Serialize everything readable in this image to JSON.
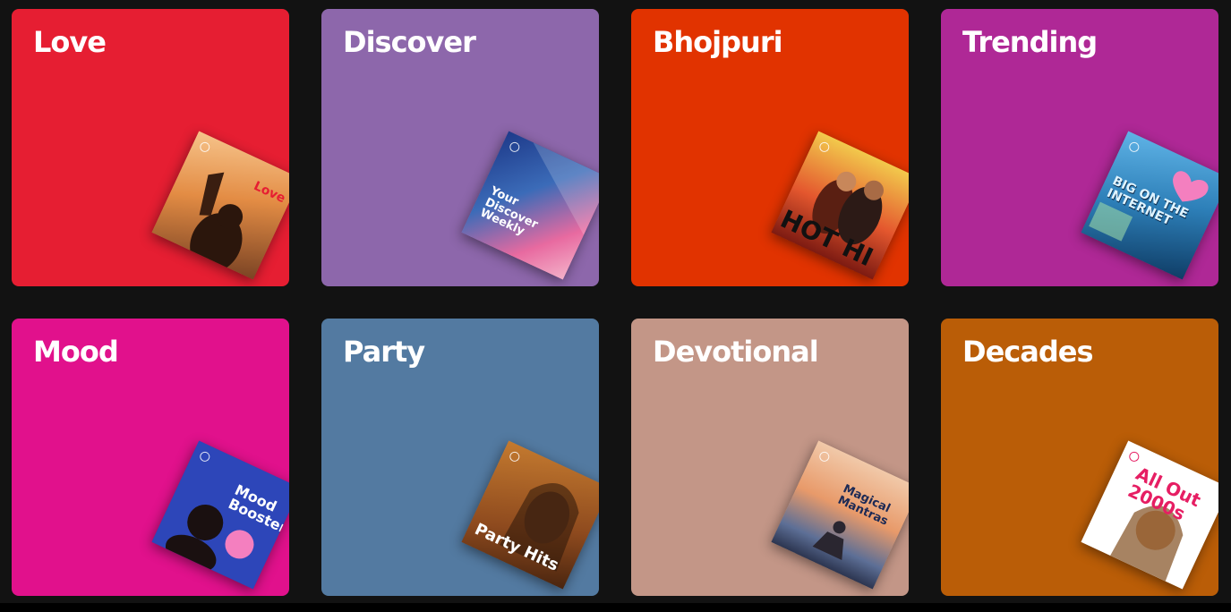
{
  "categories": [
    {
      "title": "Love",
      "color": "#e61e32",
      "cover": {
        "text": "Love",
        "art": "sunset-heart-silhouette"
      }
    },
    {
      "title": "Discover",
      "color": "#8d67ab",
      "cover": {
        "text": "Your Discover Weekly",
        "art": "gradient-abstract"
      }
    },
    {
      "title": "Bhojpuri",
      "color": "#e13300",
      "cover": {
        "text": "HOT HI",
        "art": "couple-poster"
      }
    },
    {
      "title": "Trending",
      "color": "#af2896",
      "cover": {
        "text": "BIG ON THE INTERNET",
        "art": "collage"
      }
    },
    {
      "title": "Mood",
      "color": "#e1118c",
      "cover": {
        "text": "Mood Booster",
        "art": "bubblegum-portrait"
      }
    },
    {
      "title": "Party",
      "color": "#537aa1",
      "cover": {
        "text": "Party Hits",
        "art": "portrait"
      }
    },
    {
      "title": "Devotional",
      "color": "#c39687",
      "cover": {
        "text": "Magical Mantras",
        "art": "meditation-sunset"
      }
    },
    {
      "title": "Decades",
      "color": "#ba5d07",
      "cover": {
        "text": "All Out 2000s",
        "art": "portrait"
      }
    }
  ]
}
